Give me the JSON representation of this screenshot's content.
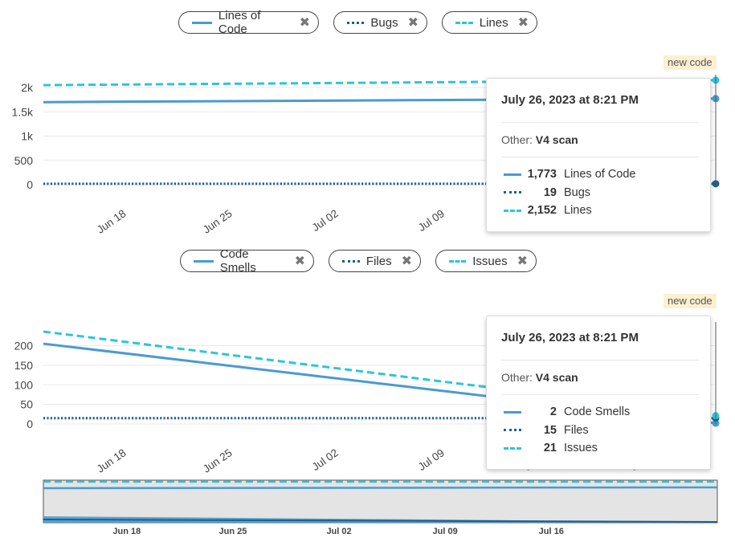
{
  "legend1": [
    {
      "label": "Lines of Code",
      "style": "solid"
    },
    {
      "label": "Bugs",
      "style": "dotted"
    },
    {
      "label": "Lines",
      "style": "dashed"
    }
  ],
  "legend2": [
    {
      "label": "Code Smells",
      "style": "solid"
    },
    {
      "label": "Files",
      "style": "dotted"
    },
    {
      "label": "Issues",
      "style": "dashed"
    }
  ],
  "new_code_label": "new code",
  "tooltip1": {
    "date": "July 26, 2023 at 8:21 PM",
    "other_label": "Other:",
    "other_value": "V4 scan",
    "rows": [
      {
        "value": "1,773",
        "name": "Lines of Code",
        "style": "solid"
      },
      {
        "value": "19",
        "name": "Bugs",
        "style": "dotted"
      },
      {
        "value": "2,152",
        "name": "Lines",
        "style": "dashed"
      }
    ]
  },
  "tooltip2": {
    "date": "July 26, 2023 at 8:21 PM",
    "other_label": "Other:",
    "other_value": "V4 scan",
    "rows": [
      {
        "value": "2",
        "name": "Code Smells",
        "style": "solid"
      },
      {
        "value": "15",
        "name": "Files",
        "style": "dotted"
      },
      {
        "value": "21",
        "name": "Issues",
        "style": "dashed"
      }
    ]
  },
  "colors": {
    "solid": "#4a9ad0",
    "dotted": "#1f5f8b",
    "dashed": "#2ec5d8",
    "grid": "#e8e8e8",
    "axis_text": "#444444"
  },
  "chart_data": [
    {
      "type": "line",
      "title": "",
      "xlabel": "",
      "ylabel": "",
      "x": [
        "2023-06-12",
        "2023-07-26"
      ],
      "xticks": [
        "Jun 18",
        "Jun 25",
        "Jul 02",
        "Jul 09",
        "Jul 16",
        "Jul 23"
      ],
      "yticks": [
        "0",
        "500",
        "1k",
        "1.5k",
        "2k"
      ],
      "ylim": [
        0,
        2100
      ],
      "grid": true,
      "series": [
        {
          "name": "Lines of Code",
          "style": "solid",
          "values": [
            1700,
            1773
          ]
        },
        {
          "name": "Bugs",
          "style": "dotted",
          "values": [
            19,
            19
          ]
        },
        {
          "name": "Lines",
          "style": "dashed",
          "values": [
            2050,
            2152
          ]
        }
      ]
    },
    {
      "type": "line",
      "title": "",
      "xlabel": "",
      "ylabel": "",
      "x": [
        "2023-06-12",
        "2023-07-26"
      ],
      "xticks": [
        "Jun 18",
        "Jun 25",
        "Jul 02",
        "Jul 09",
        "Jul 16",
        "Jul 23"
      ],
      "yticks": [
        "0",
        "50",
        "100",
        "150",
        "200"
      ],
      "ylim": [
        0,
        240
      ],
      "grid": true,
      "series": [
        {
          "name": "Code Smells",
          "style": "solid",
          "values": [
            205,
            2
          ]
        },
        {
          "name": "Files",
          "style": "dotted",
          "values": [
            15,
            15
          ]
        },
        {
          "name": "Issues",
          "style": "dashed",
          "values": [
            236,
            21
          ]
        }
      ]
    },
    {
      "type": "area",
      "title": "",
      "xticks": [
        "Jun 18",
        "Jun 25",
        "Jul 02",
        "Jul 09",
        "Jul 16"
      ]
    }
  ]
}
